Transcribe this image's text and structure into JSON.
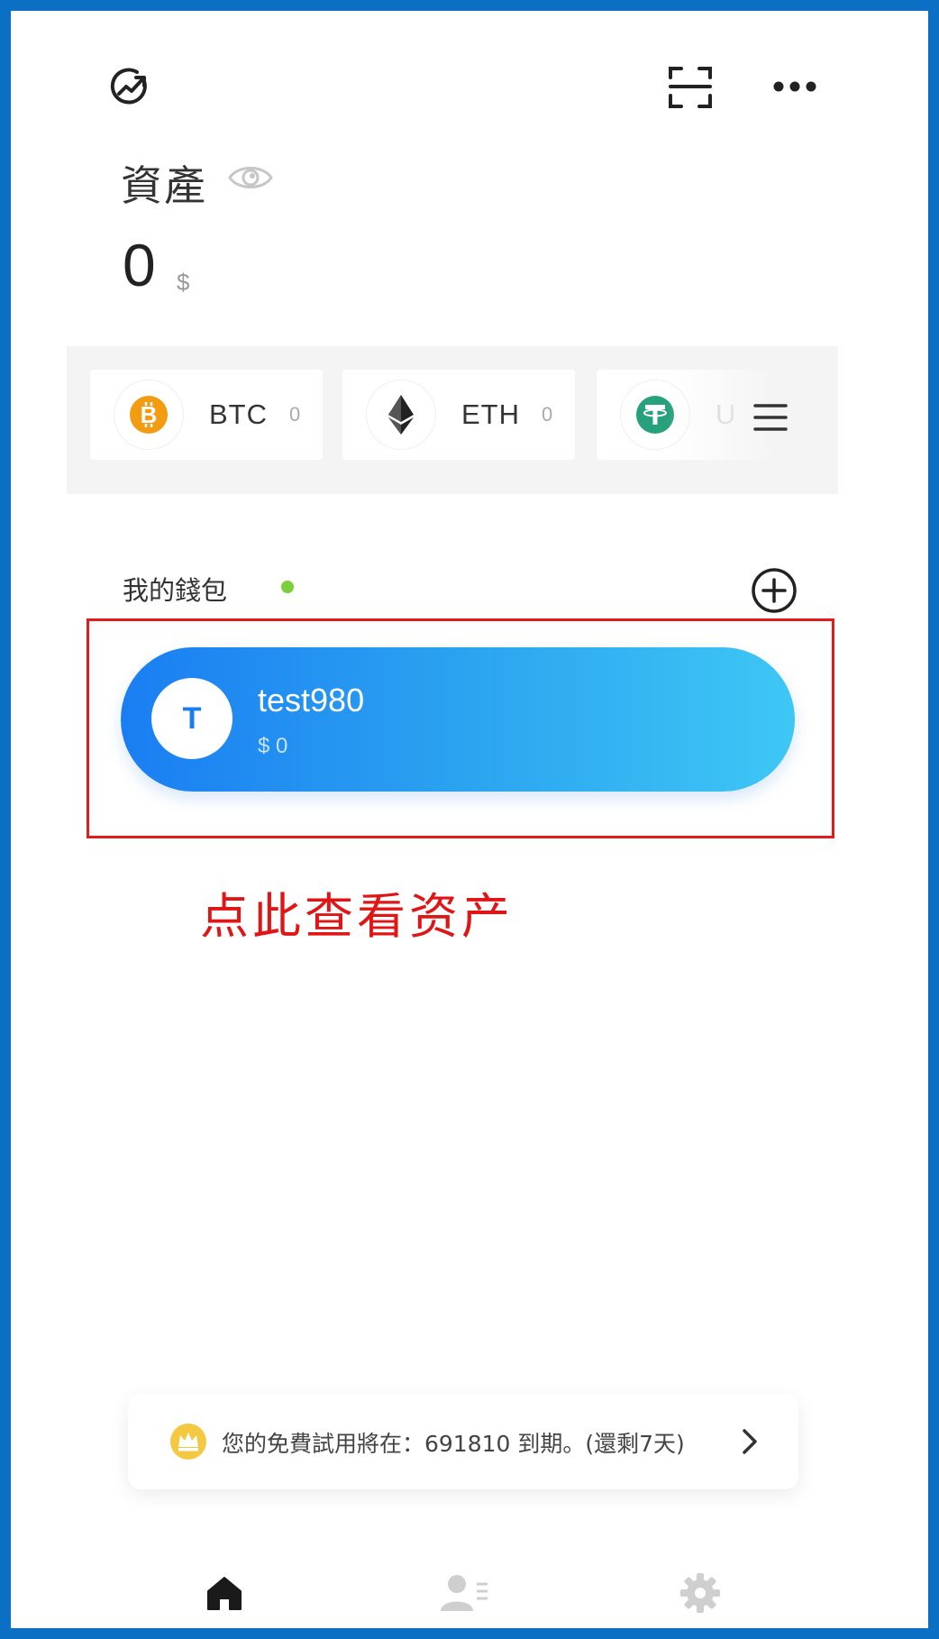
{
  "header": {
    "assets_title": "資產",
    "total_value": "0",
    "total_unit": "$"
  },
  "coins": [
    {
      "symbol": "BTC",
      "amount": "0",
      "color": "#f39c12",
      "icon": "bitcoin-icon"
    },
    {
      "symbol": "ETH",
      "amount": "0",
      "color": "#222222",
      "icon": "ethereum-icon"
    },
    {
      "symbol": "U",
      "amount": "",
      "color": "#26a17b",
      "icon": "tether-icon"
    }
  ],
  "wallets": {
    "header": "我的錢包",
    "items": [
      {
        "avatar_letter": "T",
        "name": "test980",
        "balance": "$ 0"
      }
    ]
  },
  "annotation": {
    "hint": "点此查看资产",
    "color": "#e01515"
  },
  "trial_banner": {
    "text": "您的免費試用將在：691810 到期。(還剩7天)"
  },
  "nav": {
    "tabs": [
      "home",
      "contacts",
      "settings"
    ],
    "active": "home"
  },
  "colors": {
    "frame": "#0b6fc4",
    "wallet_gradient_start": "#1a7ef2",
    "wallet_gradient_end": "#3ec7f5",
    "online": "#7bcf3a"
  }
}
